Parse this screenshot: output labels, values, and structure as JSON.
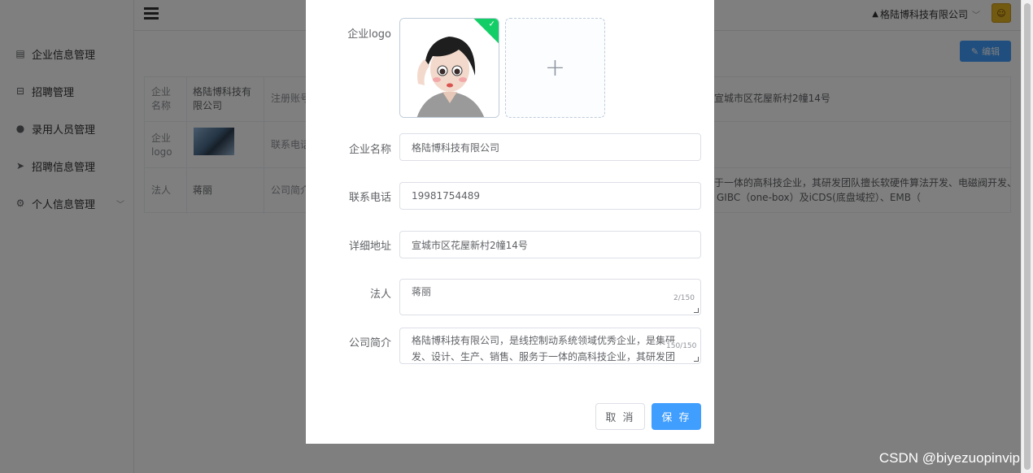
{
  "sidebar": {
    "items": [
      {
        "label": "企业信息管理"
      },
      {
        "label": "招聘管理"
      },
      {
        "label": "录用人员管理"
      },
      {
        "label": "招聘信息管理"
      },
      {
        "label": "个人信息管理"
      }
    ]
  },
  "topbar": {
    "company": "格陆博科技有限公司"
  },
  "main": {
    "edit_label": "编辑",
    "table": {
      "row1": {
        "head": "企业名称",
        "value": "格陆博科技有限公司",
        "head2": "注册账号",
        "tail": "宣城市区花屋新村2幢14号"
      },
      "row2": {
        "head": "企业logo",
        "head2": "联系电话"
      },
      "row3": {
        "head": "法人",
        "value": "蒋丽",
        "head2": "公司简介",
        "tail1": "于一体的高科技企业，其研发团队擅长软硬件算法开发、电磁阀开发、",
        "tail2": "GIBC（one-box）及iCDS(底盘域控）、EMB（"
      }
    }
  },
  "dialog": {
    "logo_label": "企业logo",
    "name_label": "企业名称",
    "name_value": "格陆博科技有限公司",
    "phone_label": "联系电话",
    "phone_value": "19981754489",
    "address_label": "详细地址",
    "address_value": "宣城市区花屋新村2幢14号",
    "legal_label": "法人",
    "legal_value": "蒋丽",
    "legal_count": "2/150",
    "intro_label": "公司简介",
    "intro_value": "格陆博科技有限公司，是线控制动系统领域优秀企业，是集研发、设计、生产、销售、服务于一体的高科技企业，其研发团队擅长软硬件算法开发、电磁阀开发、",
    "intro_count": "150/150",
    "cancel_label": "取 消",
    "save_label": "保 存"
  },
  "watermark": "CSDN @biyezuopinvip"
}
